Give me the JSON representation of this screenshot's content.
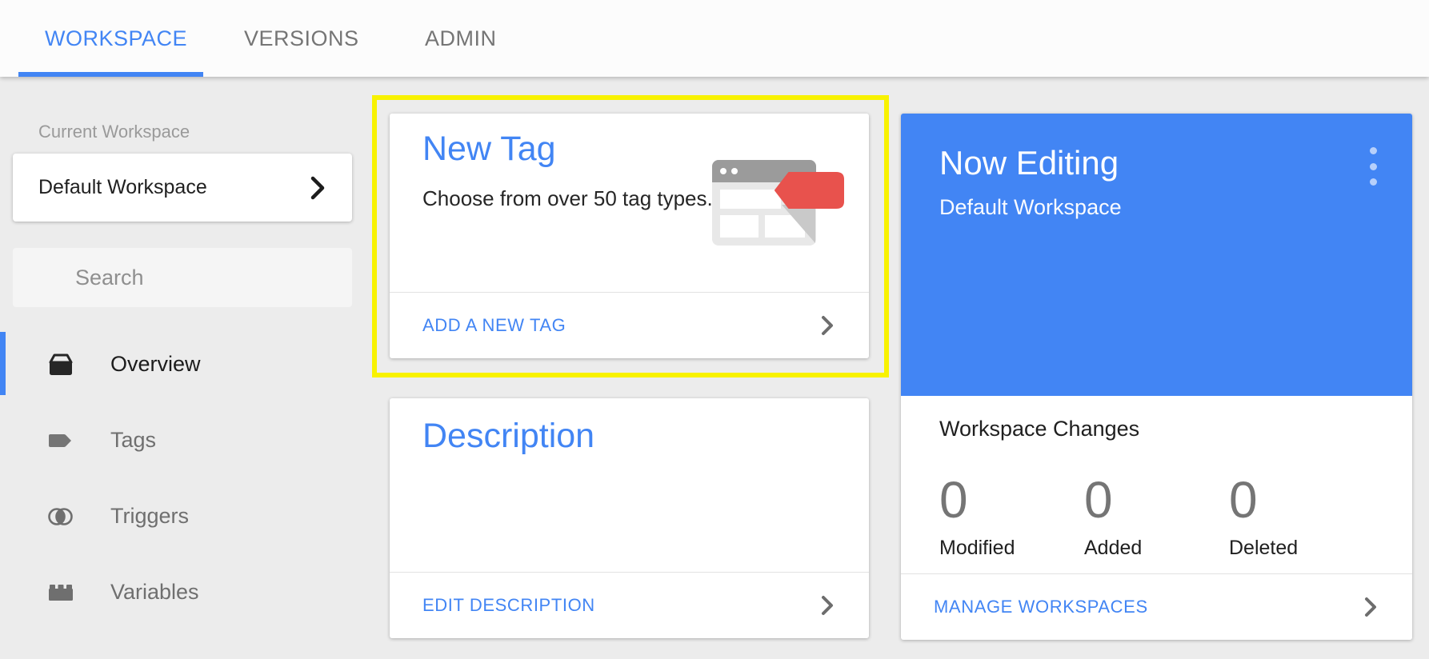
{
  "tabs": {
    "workspace": "WORKSPACE",
    "versions": "VERSIONS",
    "admin": "ADMIN"
  },
  "sidebar": {
    "current_workspace_label": "Current Workspace",
    "workspace_name": "Default Workspace",
    "search_placeholder": "Search",
    "items": [
      {
        "label": "Overview",
        "icon": "overview-box-icon",
        "active": true
      },
      {
        "label": "Tags",
        "icon": "tag-icon",
        "active": false
      },
      {
        "label": "Triggers",
        "icon": "triggers-icon",
        "active": false
      },
      {
        "label": "Variables",
        "icon": "variables-brick-icon",
        "active": false
      }
    ]
  },
  "cards": {
    "new_tag": {
      "title": "New Tag",
      "body": "Choose from over 50 tag types.",
      "action": "ADD A NEW TAG",
      "highlighted": true
    },
    "description": {
      "title": "Description",
      "action": "EDIT DESCRIPTION"
    },
    "now_editing": {
      "title": "Now Editing",
      "subtitle": "Default Workspace",
      "section_title": "Workspace Changes",
      "stats": [
        {
          "value": "0",
          "label": "Modified"
        },
        {
          "value": "0",
          "label": "Added"
        },
        {
          "value": "0",
          "label": "Deleted"
        }
      ],
      "action": "MANAGE WORKSPACES"
    }
  },
  "colors": {
    "accent_blue": "#4285f4",
    "highlight_yellow": "#f8f200",
    "tag_red": "#e8524d",
    "page_background": "#ececec"
  }
}
